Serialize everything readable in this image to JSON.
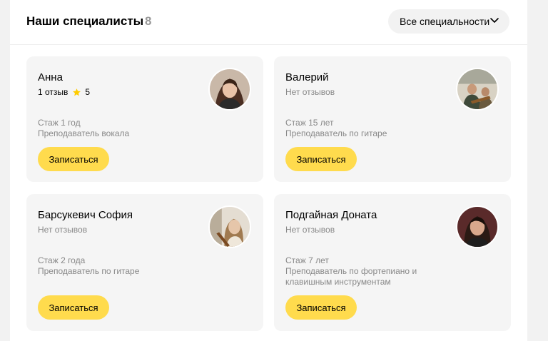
{
  "header": {
    "title": "Наши специалисты",
    "count": "8",
    "filter_label": "Все специальности"
  },
  "specialists": [
    {
      "name": "Анна",
      "reviews": "1 отзыв",
      "rating": "5",
      "experience": "Стаж 1 год",
      "role": "Преподаватель вокала",
      "button": "Записаться"
    },
    {
      "name": "Валерий",
      "reviews": "Нет отзывов",
      "experience": "Стаж 15 лет",
      "role": "Преподаватель по гитаре",
      "button": "Записаться"
    },
    {
      "name": "Барсукевич София",
      "reviews": "Нет отзывов",
      "experience": "Стаж 2 года",
      "role": "Преподаватель по гитаре",
      "button": "Записаться"
    },
    {
      "name": "Подгайная Доната",
      "reviews": "Нет отзывов",
      "experience": "Стаж 7 лет",
      "role": "Преподаватель по фортепиано и клавишным инструментам",
      "button": "Записаться"
    }
  ],
  "colors": {
    "accent_button": "#ffdb4d",
    "star": "#ffcc00",
    "card_bg": "#f5f5f5"
  }
}
